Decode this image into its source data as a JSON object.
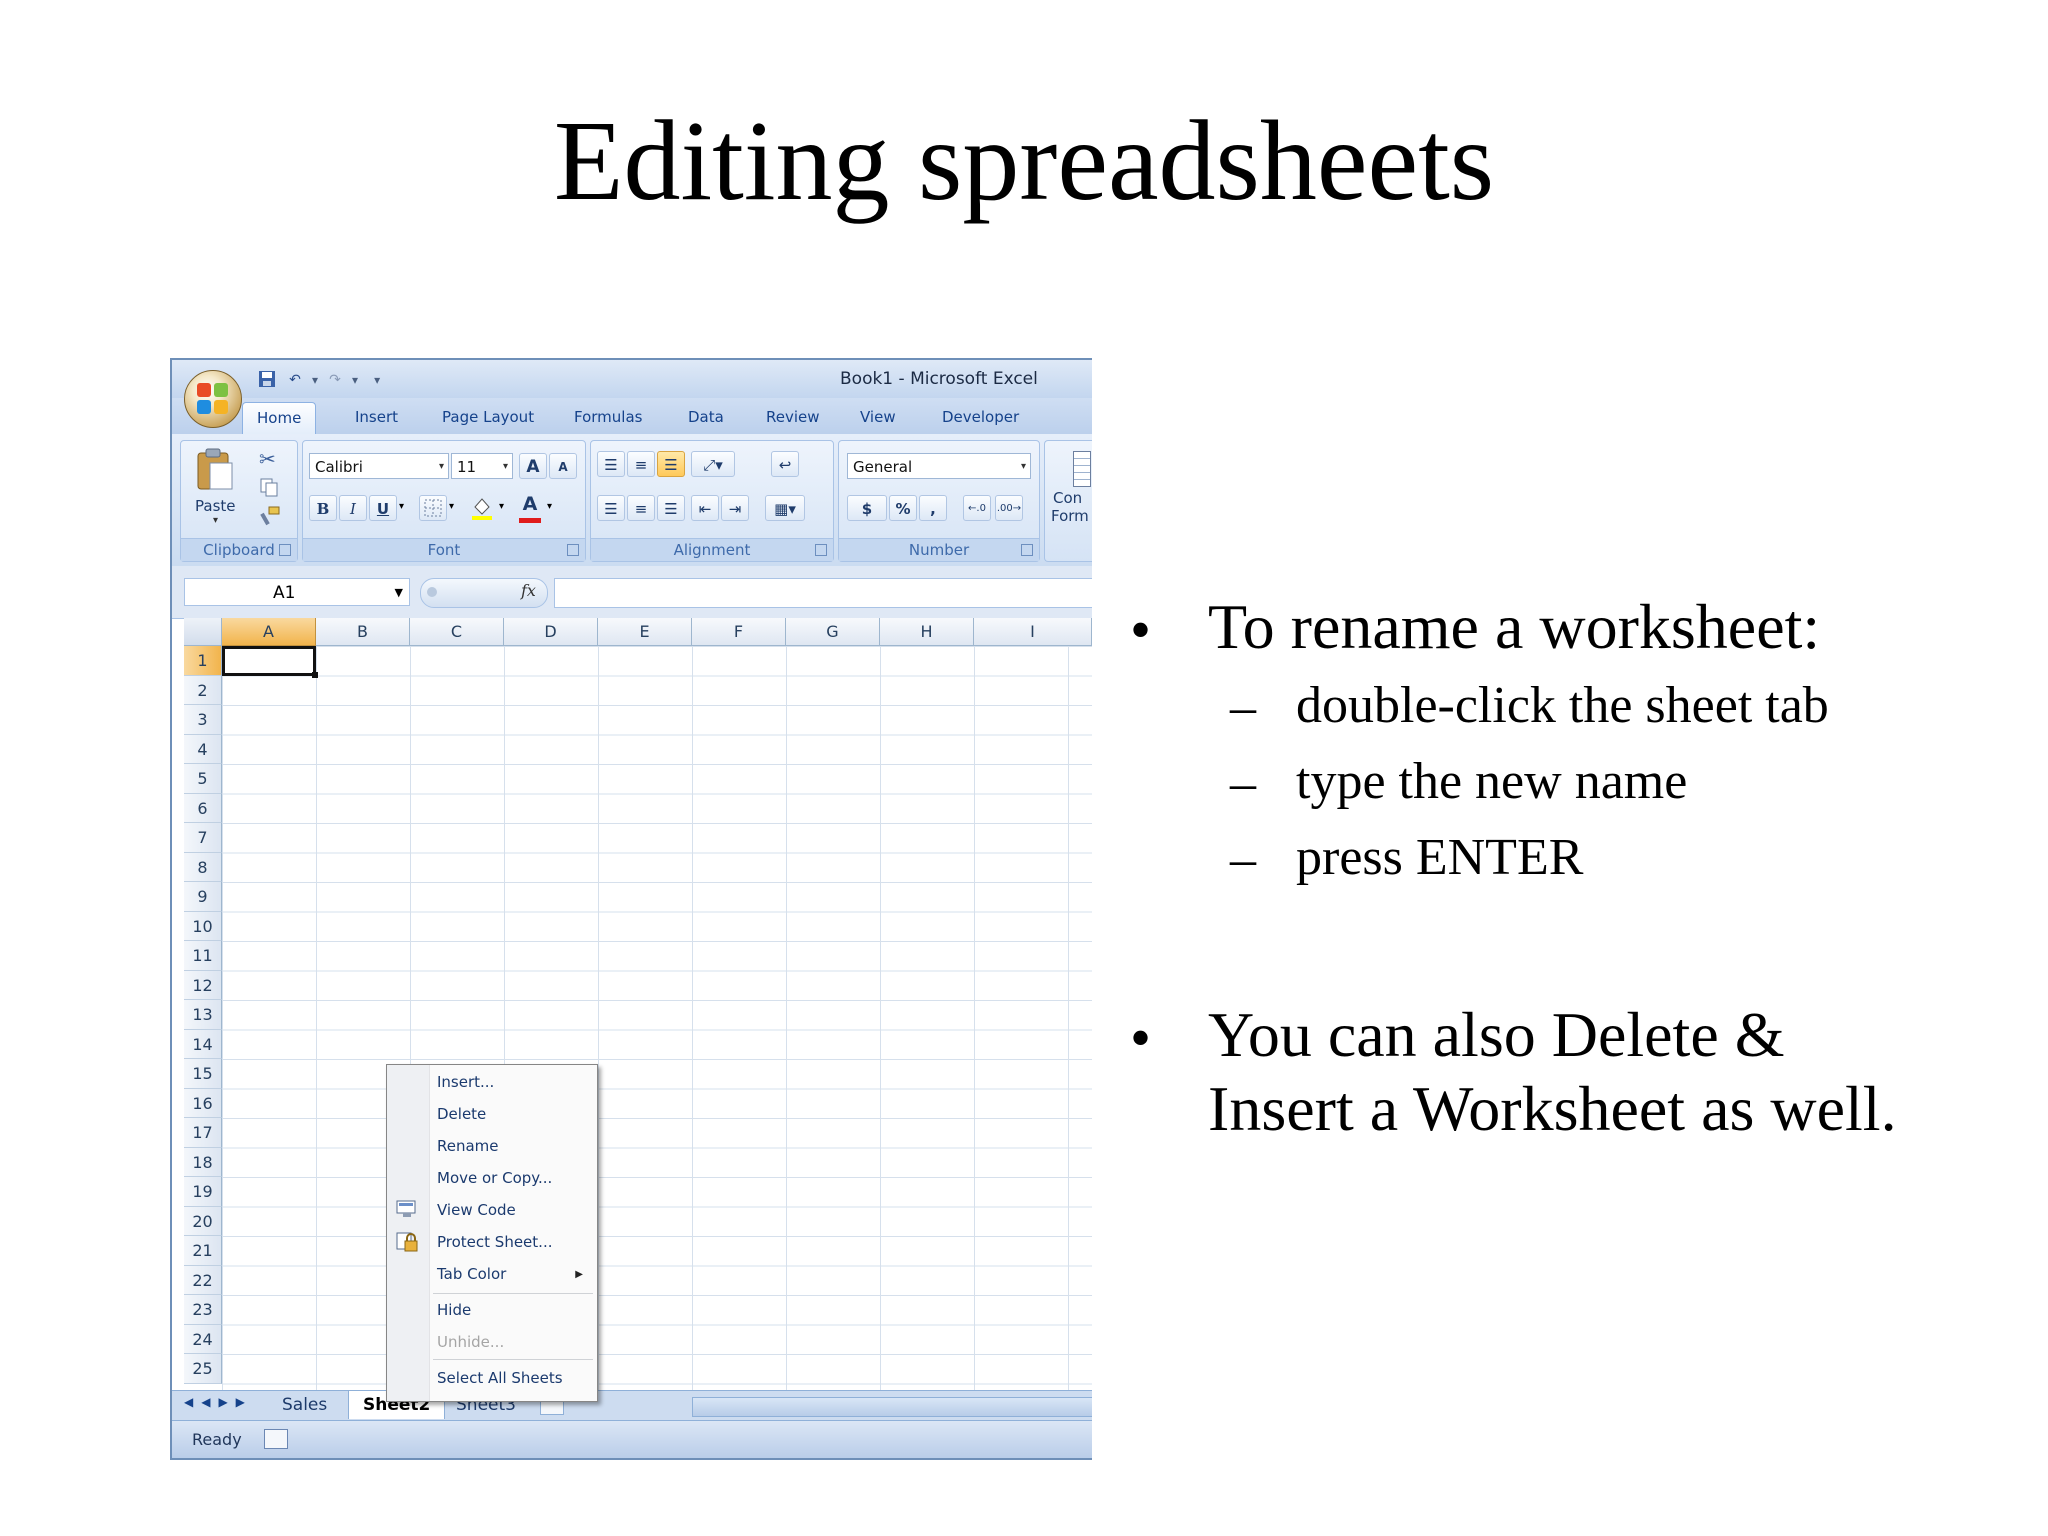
{
  "slide": {
    "title": "Editing spreadsheets",
    "bullets": [
      {
        "text": "To rename a worksheet:",
        "subitems": [
          "double-click the sheet tab",
          "type the new name",
          "press ENTER"
        ]
      },
      {
        "line1": "You can also Delete &",
        "line2": "Insert a Worksheet as well."
      }
    ]
  },
  "excel": {
    "window_title": "Book1  -  Microsoft Excel",
    "ribbon_tabs": [
      "Home",
      "Insert",
      "Page Layout",
      "Formulas",
      "Data",
      "Review",
      "View",
      "Developer"
    ],
    "active_tab": "Home",
    "groups": {
      "clipboard": "Clipboard",
      "paste": "Paste",
      "font": "Font",
      "alignment": "Alignment",
      "number": "Number",
      "cond_partial_1": "Con",
      "cond_partial_2": "Form"
    },
    "font_name": "Calibri",
    "font_size": "11",
    "number_format": "General",
    "font_buttons": {
      "bold": "B",
      "italic": "I",
      "underline": "U",
      "grow": "A",
      "shrink": "A",
      "font_color": "A"
    },
    "number_buttons": {
      "currency": "$",
      "percent": "%",
      "comma": ","
    },
    "name_box": "A1",
    "fx": "fx",
    "columns": [
      "A",
      "B",
      "C",
      "D",
      "E",
      "F",
      "G",
      "H",
      "I"
    ],
    "rows": [
      "1",
      "2",
      "3",
      "4",
      "5",
      "6",
      "7",
      "8",
      "9",
      "10",
      "11",
      "12",
      "13",
      "14",
      "15",
      "16",
      "17",
      "18",
      "19",
      "20",
      "21",
      "22",
      "23",
      "24",
      "25"
    ],
    "sheet_tabs": [
      "Sales",
      "Sheet2",
      "Sheet3"
    ],
    "active_sheet": "Sheet2",
    "status": "Ready",
    "context_menu": [
      {
        "label": "Insert...",
        "disabled": false
      },
      {
        "label": "Delete",
        "disabled": false
      },
      {
        "label": "Rename",
        "disabled": false
      },
      {
        "label": "Move or Copy...",
        "disabled": false
      },
      {
        "label": "View Code",
        "disabled": false,
        "icon": "view-code-icon"
      },
      {
        "label": "Protect Sheet...",
        "disabled": false,
        "icon": "protect-sheet-icon"
      },
      {
        "label": "Tab Color",
        "disabled": false,
        "submenu": true
      },
      {
        "label": "Hide",
        "disabled": false
      },
      {
        "label": "Unhide...",
        "disabled": true
      },
      {
        "label": "Select All Sheets",
        "disabled": false
      }
    ]
  }
}
